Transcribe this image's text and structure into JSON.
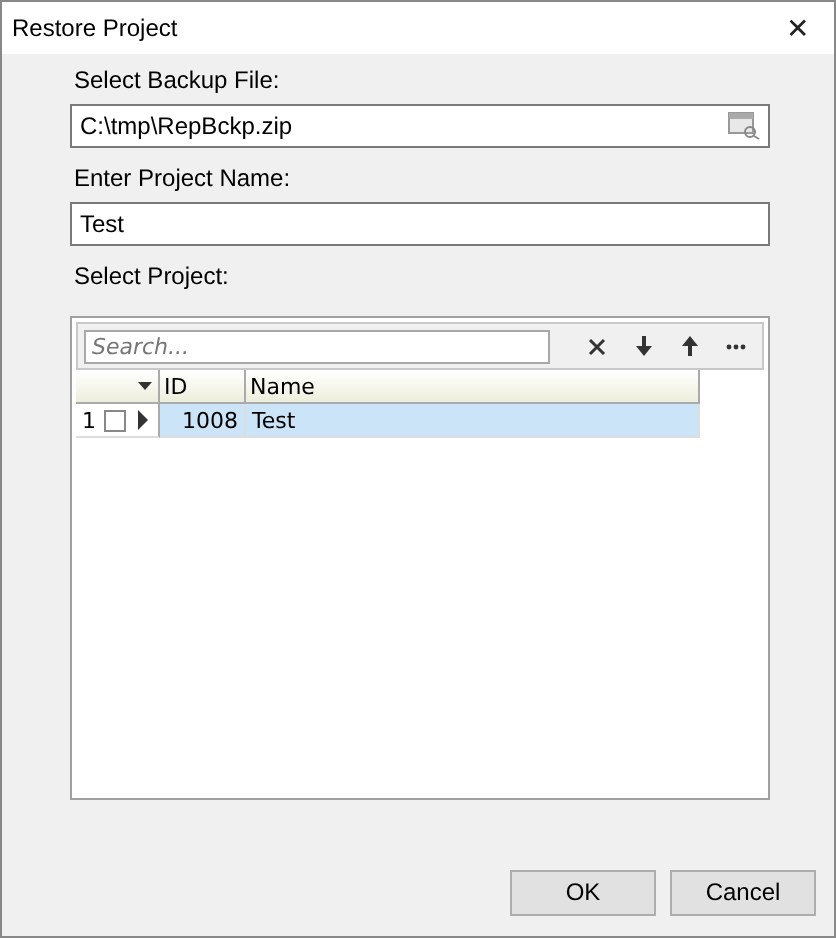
{
  "window": {
    "title": "Restore Project",
    "close": "✕"
  },
  "backup_file": {
    "label": "Select Backup File:",
    "value": "C:\\tmp\\RepBckp.zip"
  },
  "project_name": {
    "label": "Enter Project Name:",
    "value": "Test"
  },
  "project_select": {
    "label": "Select Project:",
    "search": {
      "placeholder": "Search..."
    },
    "columns": [
      "ID",
      "Name"
    ],
    "rows": [
      {
        "number": "1",
        "checked": false,
        "selected": true,
        "id": "1008",
        "name": "Test"
      }
    ]
  },
  "buttons": [
    {
      "label": "OK"
    },
    {
      "label": "Cancel"
    }
  ]
}
